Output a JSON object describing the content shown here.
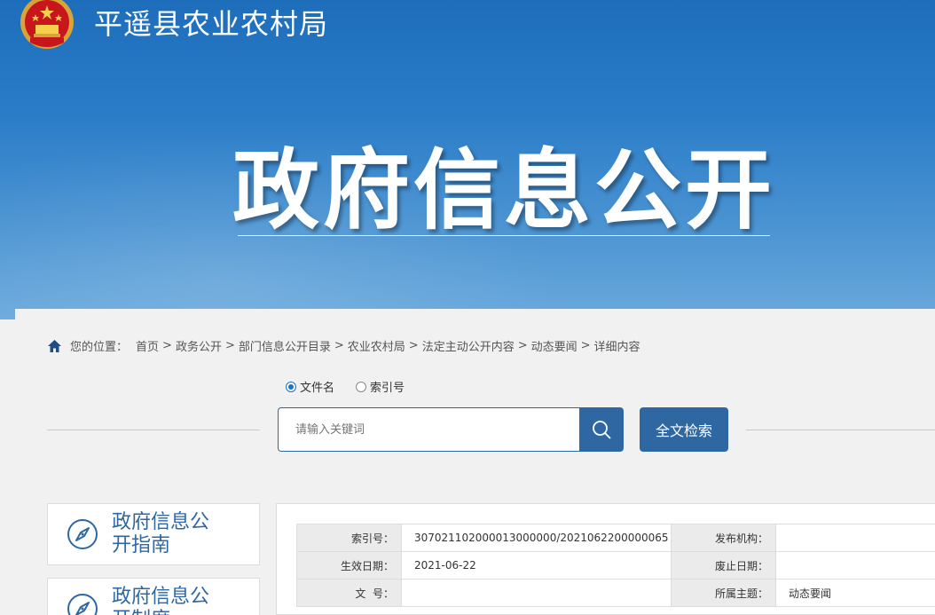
{
  "header": {
    "site_name": "平遥县农业农村局",
    "page_title": "政府信息公开"
  },
  "breadcrumb": {
    "location_label": "您的位置：",
    "items": [
      "首页",
      "政务公开",
      "部门信息公开目录",
      "农业农村局",
      "法定主动公开内容",
      "动态要闻",
      "详细内容"
    ],
    "separator": ">"
  },
  "search": {
    "options": [
      {
        "label": "文件名",
        "checked": true
      },
      {
        "label": "索引号",
        "checked": false
      }
    ],
    "placeholder": "请输入关键词",
    "fulltext_button": "全文检索"
  },
  "sidebar": {
    "items": [
      {
        "label": "政府信息公开指南"
      },
      {
        "label": "政府信息公开制度"
      }
    ]
  },
  "meta_table": {
    "rows": [
      {
        "k1": "索引号：",
        "v1": "307021102000013000000/2021062200000065",
        "k2": "发布机构：",
        "v2": ""
      },
      {
        "k1": "生效日期：",
        "v1": "2021-06-22",
        "k2": "废止日期：",
        "v2": ""
      },
      {
        "k1": "文  号：",
        "v1": "",
        "k2": "所属主题：",
        "v2": "动态要闻"
      }
    ]
  },
  "colors": {
    "brand_blue": "#2f67a3",
    "banner_top": "#1d6dbb"
  }
}
